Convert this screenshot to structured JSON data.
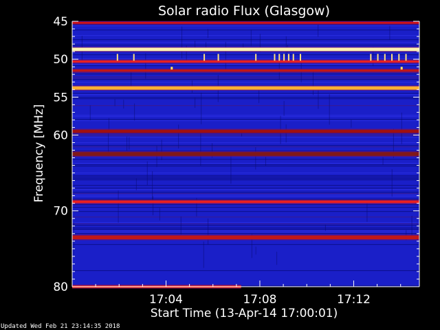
{
  "chart_data": {
    "type": "heatmap",
    "title": "Solar radio Flux (Glasgow)",
    "ylabel": "Frequency [MHz]",
    "xlabel": "Start Time (13-Apr-14 17:00:01)",
    "ylim": [
      45,
      80
    ],
    "y_ticks": [
      45,
      50,
      55,
      60,
      70,
      80
    ],
    "y_tick_labels": [
      "45",
      "50",
      "55",
      "60",
      "70",
      "80"
    ],
    "x_range_minutes": [
      0,
      14.8
    ],
    "x_ticks_minutes": [
      4,
      8,
      12
    ],
    "x_tick_labels": [
      "17:04",
      "17:08",
      "17:12"
    ],
    "background_color": "#1a1fc8",
    "bands": [
      {
        "freq": 45.2,
        "width": 0.25,
        "color": "#d01010",
        "intensity": "high"
      },
      {
        "freq": 48.7,
        "width": 0.45,
        "color": "#fff3b0",
        "intensity": "saturated"
      },
      {
        "freq": 50.3,
        "width": 0.3,
        "color": "#e82020",
        "intensity": "high"
      },
      {
        "freq": 51.5,
        "width": 0.3,
        "color": "#c01818",
        "intensity": "medium"
      },
      {
        "freq": 53.8,
        "width": 0.45,
        "color": "#ffb030",
        "intensity": "high"
      },
      {
        "freq": 59.5,
        "width": 0.4,
        "color": "#a01010",
        "intensity": "medium"
      },
      {
        "freq": 62.5,
        "width": 0.5,
        "color": "#801818",
        "intensity": "low"
      },
      {
        "freq": 68.8,
        "width": 0.35,
        "color": "#e82020",
        "intensity": "high"
      },
      {
        "freq": 73.5,
        "width": 0.5,
        "color": "#c01818",
        "intensity": "medium"
      },
      {
        "freq": 80.0,
        "width": 0.3,
        "color": "#ff3020",
        "intensity": "high",
        "x_end_minutes": 7.2
      }
    ],
    "grid": false
  },
  "footer": {
    "updated": "Updated Wed Feb 21 23:14:35 2018"
  },
  "colors": {
    "axis": "#ffffff",
    "text": "#ffffff",
    "page_background": "#000000"
  }
}
